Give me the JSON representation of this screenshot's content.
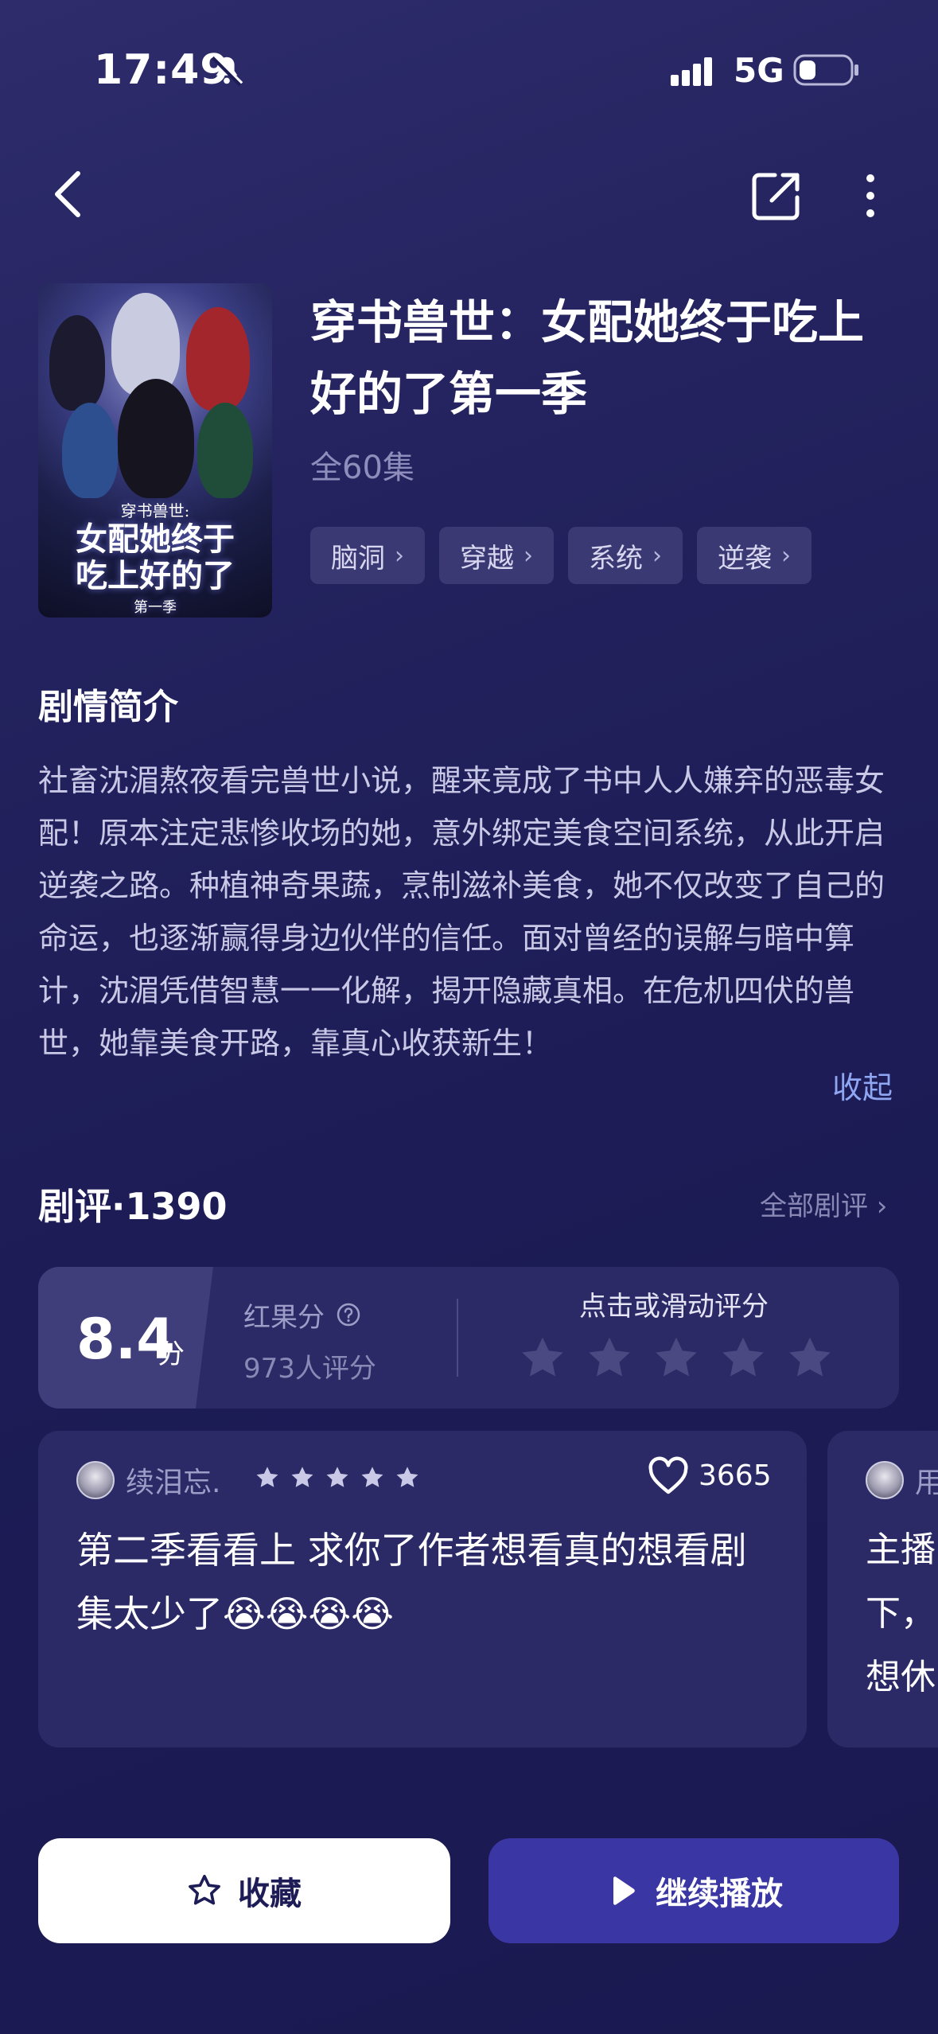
{
  "status_bar": {
    "time": "17:49",
    "network": "5G",
    "icons": [
      "bell-muted-icon",
      "signal-icon",
      "battery-icon"
    ]
  },
  "nav": {
    "icons": [
      "back-icon",
      "share-icon",
      "more-icon"
    ]
  },
  "drama": {
    "title": "穿书兽世：女配她终于吃上好的了第一季",
    "episodes": "全60集",
    "cover_text": {
      "line1": "穿书兽世:",
      "line2": "女配她终于",
      "line3": "吃上好的了",
      "line4": "第一季"
    },
    "tags": [
      {
        "label": "脑洞"
      },
      {
        "label": "穿越"
      },
      {
        "label": "系统"
      },
      {
        "label": "逆袭"
      }
    ]
  },
  "synopsis": {
    "heading": "剧情简介",
    "text": "社畜沈湄熬夜看完兽世小说，醒来竟成了书中人人嫌弃的恶毒女配！原本注定悲惨收场的她，意外绑定美食空间系统，从此开启逆袭之路。种植神奇果蔬，烹制滋补美食，她不仅改变了自己的命运，也逐渐赢得身边伙伴的信任。面对曾经的误解与暗中算计，沈湄凭借智慧一一化解，揭开隐藏真相。在危机四伏的兽世，她靠美食开路，靠真心收获新生！",
    "collapse_label": "收起"
  },
  "reviews": {
    "heading": "剧评",
    "separator": "·",
    "count": "1390",
    "all_label": "全部剧评 ›",
    "rating": {
      "score": "8.4",
      "unit": "分",
      "label": "红果分",
      "raters": "973人评分",
      "hint": "点击或滑动评分",
      "star_slots": 5
    },
    "items": [
      {
        "user": "续泪忘.",
        "stars": 5,
        "likes": "3665",
        "text": "第二季看看上 求你了作者想看真的想看剧集太少了😭😭😭😭"
      },
      {
        "user": "用",
        "text_lines": [
          "主播",
          "下，",
          "想休"
        ]
      }
    ]
  },
  "actions": {
    "favorite_label": "收藏",
    "play_label": "继续播放"
  },
  "colors": {
    "background": "#1e1d55",
    "card": "#2b2a66",
    "tag": "#3a3973",
    "accent_link": "#8fa6f2",
    "play_button": "#3a36a3"
  }
}
